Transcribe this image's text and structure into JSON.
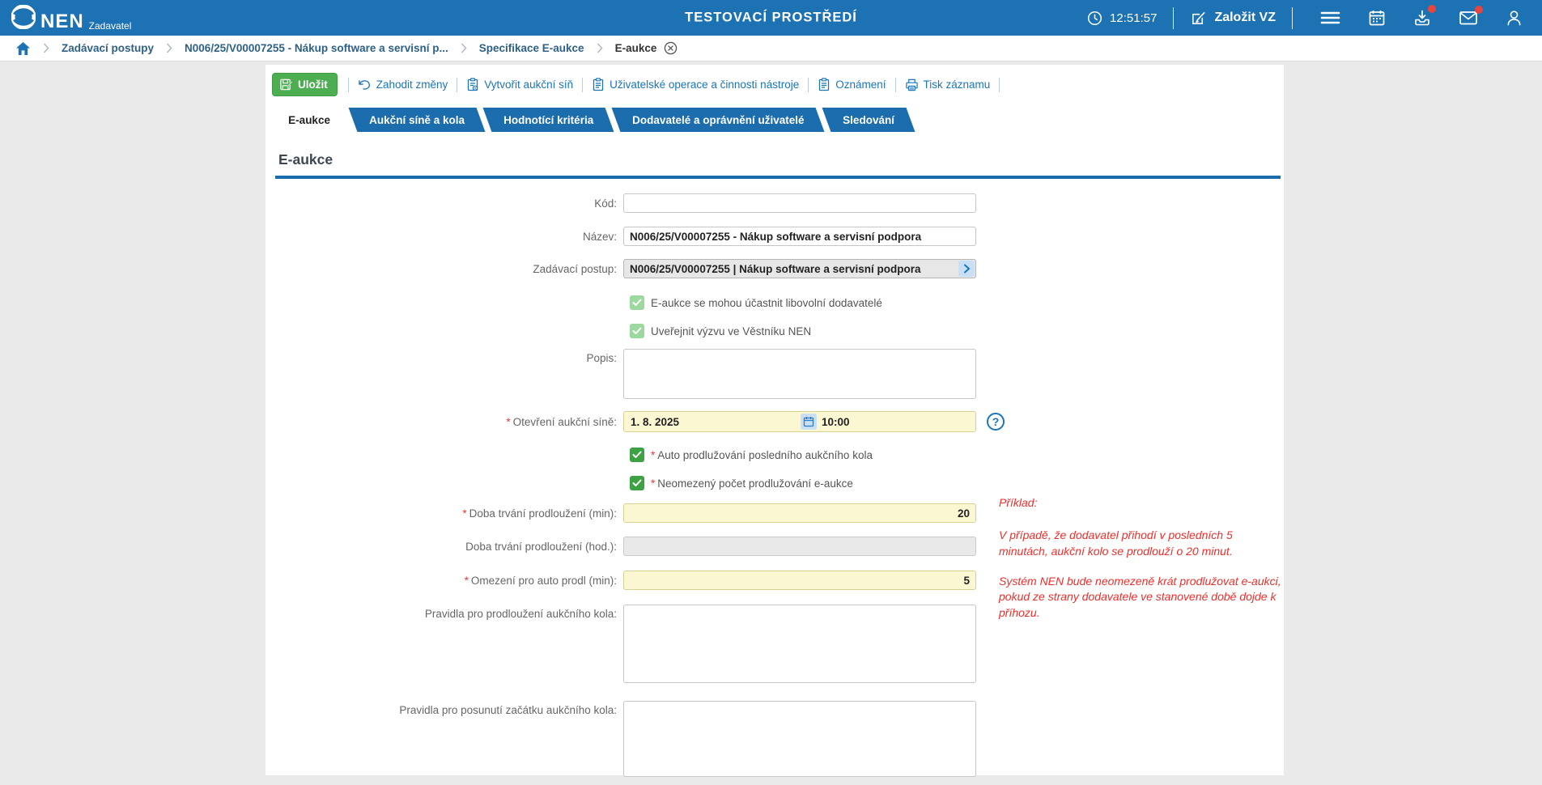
{
  "ui": {
    "required_marker": "*",
    "help_glyph": "?"
  },
  "header": {
    "brand": "NEN",
    "brand_sub": "Zadavatel",
    "title": "TESTOVACÍ PROSTŘEDÍ",
    "time": "12:51:57",
    "create_vz_label": "Založit VZ"
  },
  "breadcrumb": {
    "items": [
      "Zadávací postupy",
      "N006/25/V00007255 - Nákup software a servisní p...",
      "Specifikace E-aukce"
    ],
    "current": "E-aukce"
  },
  "toolbar": {
    "save_label": "Uložit",
    "discard_label": "Zahodit změny",
    "create_room_label": "Vytvořit aukční síň",
    "user_ops_label": "Uživatelské operace a činnosti nástroje",
    "notices_label": "Oznámení",
    "print_label": "Tisk záznamu"
  },
  "tabs": [
    {
      "label": "E-aukce",
      "active": true
    },
    {
      "label": "Aukční síně a kola",
      "active": false
    },
    {
      "label": "Hodnotící kritéria",
      "active": false
    },
    {
      "label": "Dodavatelé a oprávnění uživatelé",
      "active": false
    },
    {
      "label": "Sledování",
      "active": false
    }
  ],
  "section_title": "E-aukce",
  "form": {
    "kod": {
      "label": "Kód:",
      "value": ""
    },
    "nazev": {
      "label": "Název:",
      "value": "N006/25/V00007255 - Nákup software a servisní podpora"
    },
    "zadavaci_postup": {
      "label": "Zadávací postup:",
      "value": "N006/25/V00007255 | Nákup software a servisní podpora"
    },
    "cb_libovolni_label": "E-aukce se mohou účastnit libovolní dodavatelé",
    "cb_vestnik_label": "Uveřejnit výzvu ve Věstníku NEN",
    "popis": {
      "label": "Popis:",
      "value": ""
    },
    "otevreni": {
      "label": "Otevření aukční síně:",
      "date": "1. 8. 2025",
      "time": "10:00"
    },
    "cb_auto_label": "Auto prodlužování posledního aukčního kola",
    "cb_neomezeny_label": "Neomezený počet prodlužování e-aukce",
    "doba_min": {
      "label": "Doba trvání prodloužení (min):",
      "value": "20"
    },
    "doba_hod": {
      "label": "Doba trvání prodloužení (hod.):",
      "value": ""
    },
    "omezeni": {
      "label": "Omezení pro auto prodl (min):",
      "value": "5"
    },
    "pravidla_prodlouzeni": {
      "label": "Pravidla pro prodloužení aukčního kola:",
      "value": ""
    },
    "pravidla_posunuti": {
      "label": "Pravidla pro posunutí začátku aukčního kola:",
      "value": ""
    }
  },
  "notes": {
    "title": "Příklad:",
    "p1": "V případě, že dodavatel přihodí v posledních 5 minutách, aukční kolo se prodlouží o 20 minut.",
    "p2": "Systém NEN bude neomezeně krát prodlužovat e-aukci, pokud ze strany dodavatele ve stanovené době dojde k příhozu."
  },
  "colors": {
    "header_blue": "#1d72b3",
    "tab_blue": "#1b6dad",
    "accent_rule": "#1a6cad",
    "save_green": "#4cae50",
    "required_yellow": "#fbf7d3",
    "note_red": "#ee2f2c",
    "link_blue": "#1a75bc"
  }
}
